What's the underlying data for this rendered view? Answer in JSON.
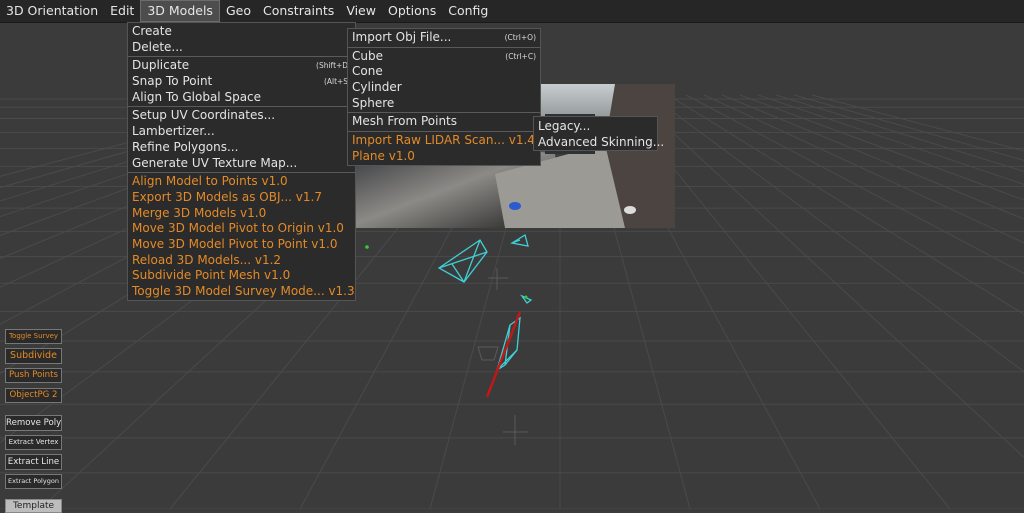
{
  "menubar": [
    {
      "label": "3D Orientation",
      "active": false
    },
    {
      "label": "Edit",
      "active": false
    },
    {
      "label": "3D Models",
      "active": true
    },
    {
      "label": "Geo",
      "active": false
    },
    {
      "label": "Constraints",
      "active": false
    },
    {
      "label": "View",
      "active": false
    },
    {
      "label": "Options",
      "active": false
    },
    {
      "label": "Config",
      "active": false
    }
  ],
  "models_menu": {
    "create": "Create",
    "delete": "Delete...",
    "duplicate": "Duplicate",
    "duplicate_sc": "(Shift+D)",
    "snap": "Snap To Point",
    "snap_sc": "(Alt+S)",
    "align_global": "Align To Global Space",
    "setup_uv": "Setup UV Coordinates...",
    "lambertizer": "Lambertizer...",
    "refine": "Refine Polygons...",
    "gen_uv": "Generate UV Texture Map...",
    "scripts": [
      "Align Model to Points  v1.0",
      "Export 3D Models as OBJ...  v1.7",
      "Merge 3D Models  v1.0",
      "Move 3D Model Pivot to Origin  v1.0",
      "Move 3D Model Pivot to Point  v1.0",
      "Reload 3D Models...  v1.2",
      "Subdivide Point Mesh  v1.0",
      "Toggle 3D Model Survey Mode...  v1.3"
    ]
  },
  "create_menu": {
    "import_obj": "Import Obj File...",
    "import_obj_sc": "(Ctrl+O)",
    "cube": "Cube",
    "cube_sc": "(Ctrl+C)",
    "cone": "Cone",
    "cylinder": "Cylinder",
    "sphere": "Sphere",
    "mesh_from_points": "Mesh From Points",
    "import_lidar": "Import Raw LIDAR Scan...  v1.4",
    "plane": "Plane  v1.0"
  },
  "mesh_menu": {
    "legacy": "Legacy...",
    "advanced": "Advanced Skinning..."
  },
  "toolbar": {
    "toggle_survey": "Toggle Survey",
    "subdivide": "Subdivide",
    "push_points": "Push Points",
    "objectpg": "ObjectPG 2",
    "remove_poly": "Remove Poly",
    "extract_vertex": "Extract Vertex",
    "extract_line": "Extract Line",
    "extract_polygon": "Extract Polygon",
    "template": "Template"
  },
  "colors": {
    "accent_orange": "#e38a28",
    "menu_bg": "#2b2b2b",
    "viewport_bg": "#3b3b3b",
    "mesh_cyan": "#3fd0d6",
    "axis_red": "#c01818",
    "point_green": "#33cc33"
  }
}
